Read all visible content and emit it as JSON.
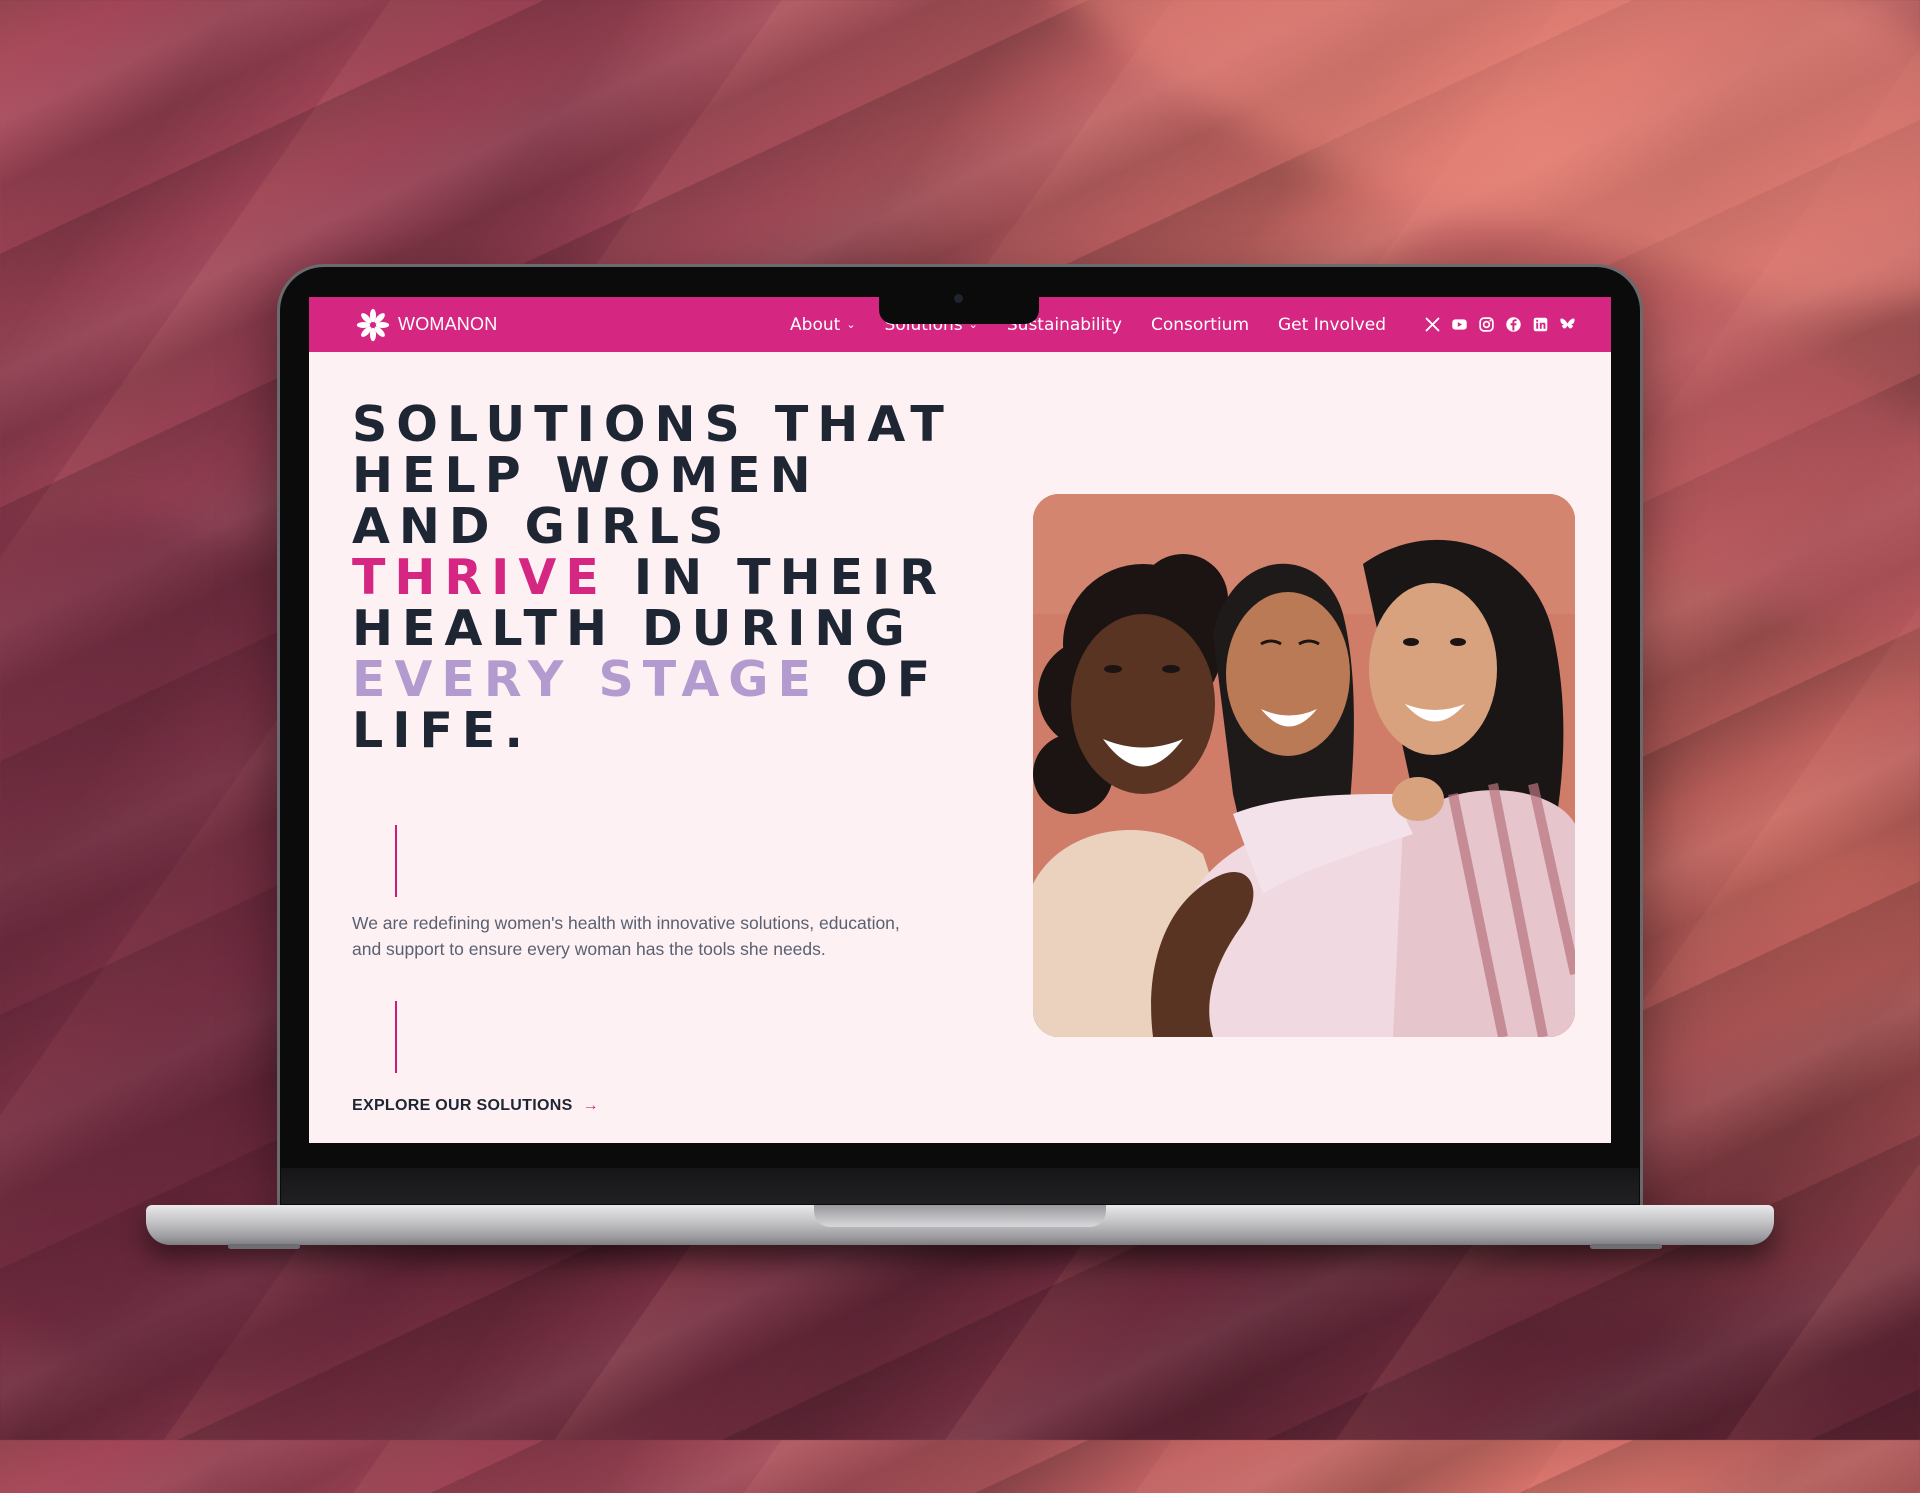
{
  "brand": {
    "name": "WOMANON",
    "color": "#d52682"
  },
  "nav": {
    "items": [
      {
        "label": "About",
        "has_dropdown": true
      },
      {
        "label": "Solutions",
        "has_dropdown": true
      },
      {
        "label": "Sustainability",
        "has_dropdown": false
      },
      {
        "label": "Consortium",
        "has_dropdown": false
      },
      {
        "label": "Get Involved",
        "has_dropdown": false
      }
    ],
    "social_icons": [
      "x-icon",
      "youtube-icon",
      "instagram-icon",
      "facebook-icon",
      "linkedin-icon",
      "bluesky-icon"
    ]
  },
  "hero": {
    "headline": {
      "line1": "SOLUTIONS THAT",
      "line2": "HELP WOMEN",
      "line3": "AND GIRLS",
      "line4_accent": "THRIVE",
      "line4_rest": " IN THEIR",
      "line5": "HEALTH DURING",
      "line6_accent": "EVERY STAGE",
      "line6_rest": " OF",
      "line7": "LIFE."
    },
    "description": "We are redefining women's health with innovative solutions, education, and support to ensure every woman has the tools she needs.",
    "cta_label": "EXPLORE OUR SOLUTIONS",
    "colors": {
      "text": "#1e2533",
      "accent_pink": "#d52682",
      "accent_lavender": "#b39bcf",
      "background": "#fdf1f4"
    }
  }
}
